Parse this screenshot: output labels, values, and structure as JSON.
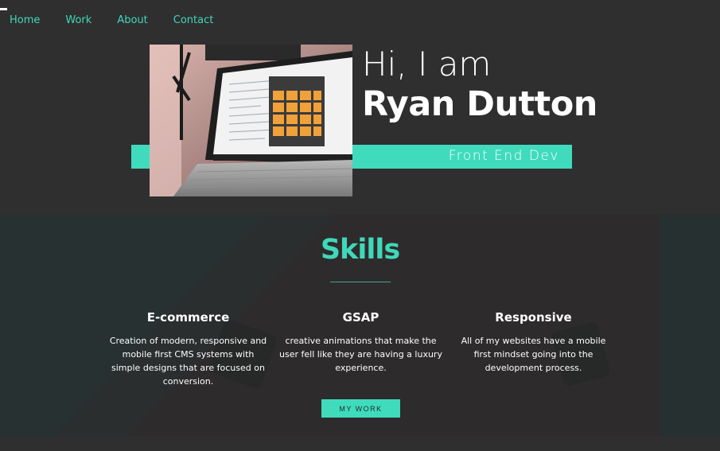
{
  "nav": {
    "links": [
      {
        "label": "Home"
      },
      {
        "label": "Work"
      },
      {
        "label": "About"
      },
      {
        "label": "Contact"
      }
    ]
  },
  "hero": {
    "greeting": "Hi, I am",
    "name": "Ryan Dutton",
    "role": "Front End Dev",
    "photo_icon": "laptop-photo"
  },
  "skills": {
    "title": "Skills",
    "items": [
      {
        "title": "E-commerce",
        "description": "Creation of modern, responsive and mobile first CMS systems with simple designs that are focused on conversion."
      },
      {
        "title": "GSAP",
        "description": "creative animations that make the user fell like they are having a luxury experience."
      },
      {
        "title": "Responsive",
        "description": "All of my websites have a mobile first mindset going into the development process."
      }
    ],
    "button_label": "MY WORK"
  },
  "colors": {
    "accent": "#40dbbd",
    "background": "#2f2f2f",
    "skills_background": "#283030"
  }
}
